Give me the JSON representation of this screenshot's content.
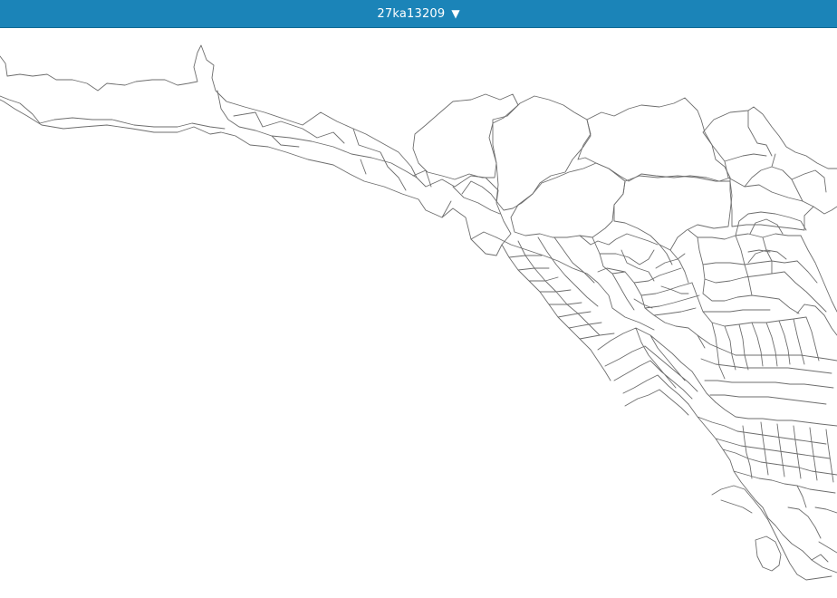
{
  "header": {
    "title": "27ka13209",
    "dropdown_icon": "triangle-down-icon",
    "background_color": "#1b84b8",
    "text_color": "#ffffff"
  },
  "map": {
    "line_color": "#6d6d6d",
    "background_color": "#ffffff"
  }
}
